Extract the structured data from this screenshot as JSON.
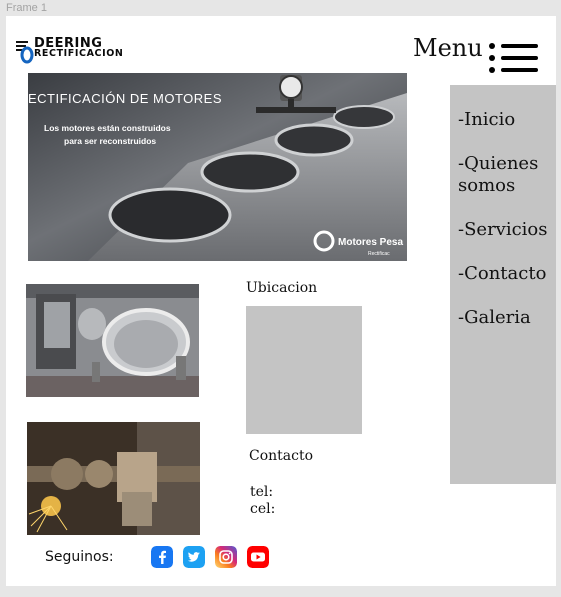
{
  "frame": {
    "label": "Frame 1"
  },
  "logo": {
    "line1": "DEERING",
    "line2": "RECTIFICACION"
  },
  "menu": {
    "title": "Menu"
  },
  "nav": {
    "items": [
      {
        "label": "-Inicio"
      },
      {
        "label": "-Quienes\n somos"
      },
      {
        "label": "-Servicios"
      },
      {
        "label": "-Contacto"
      },
      {
        "label": "-Galeria"
      }
    ]
  },
  "hero": {
    "heading": "ECTIFICACIÓN DE MOTORES",
    "subtitle_line1": "Los motores están construidos",
    "subtitle_line2": "para ser reconstruidos",
    "watermark": "Motores Pesa",
    "watermark_small": "Rectificac"
  },
  "location": {
    "label": "Ubicacion"
  },
  "contact": {
    "label": "Contacto",
    "tel": "tel:",
    "cel": "cel:"
  },
  "social": {
    "label": "Seguinos:",
    "icons": [
      "facebook-icon",
      "twitter-icon",
      "instagram-icon",
      "youtube-icon"
    ],
    "colors": {
      "facebook": "#1877f2",
      "twitter": "#1da1f2",
      "instagram": "#c13584",
      "youtube": "#ff0000"
    }
  },
  "colors": {
    "sidebar": "#c4c4c4",
    "map_placeholder": "#c4c4c4",
    "canvas": "#e6e6e6"
  }
}
